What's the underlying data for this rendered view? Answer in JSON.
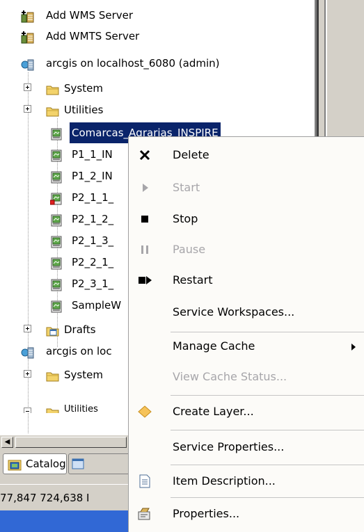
{
  "tree": {
    "nodes": [
      {
        "label": "Add WMS Server",
        "icon": "add-wms-server-icon"
      },
      {
        "label": "Add WMTS Server",
        "icon": "add-wmts-server-icon"
      },
      {
        "label": "arcgis on localhost_6080 (admin)",
        "icon": "arcgis-server-connection-icon"
      },
      {
        "label": "System",
        "icon": "folder-icon"
      },
      {
        "label": "Utilities",
        "icon": "folder-icon"
      },
      {
        "label": "Comarcas_Agrarias_INSPIRE",
        "icon": "map-service-icon"
      },
      {
        "label": "P1_1_IN",
        "icon": "map-service-icon"
      },
      {
        "label": "P1_2_IN",
        "icon": "map-service-icon"
      },
      {
        "label": "P2_1_1_",
        "icon": "map-service-stopped-icon"
      },
      {
        "label": "P2_1_2_",
        "icon": "map-service-icon"
      },
      {
        "label": "P2_1_3_",
        "icon": "map-service-icon"
      },
      {
        "label": "P2_2_1_",
        "icon": "map-service-icon"
      },
      {
        "label": "P2_3_1_",
        "icon": "map-service-icon"
      },
      {
        "label": "SampleW",
        "icon": "map-service-icon"
      },
      {
        "label": "Drafts",
        "icon": "drafts-folder-icon"
      },
      {
        "label": "arcgis on loc",
        "icon": "arcgis-server-connection-icon"
      },
      {
        "label": "System",
        "icon": "folder-icon"
      },
      {
        "label": "Utilities",
        "icon": "folder-icon"
      }
    ]
  },
  "tabs": {
    "catalog_label": "Catalog"
  },
  "status": {
    "coordinates": "77,847  724,638 I"
  },
  "context_menu": {
    "items": [
      {
        "label": "Delete",
        "enabled": true,
        "icon": "delete-x-icon"
      },
      {
        "label": "Start",
        "enabled": false,
        "icon": "start-play-icon"
      },
      {
        "label": "Stop",
        "enabled": true,
        "icon": "stop-square-icon"
      },
      {
        "label": "Pause",
        "enabled": false,
        "icon": "pause-icon"
      },
      {
        "label": "Restart",
        "enabled": true,
        "icon": "restart-icon"
      },
      {
        "label": "Service Workspaces...",
        "enabled": true,
        "icon": ""
      },
      {
        "label": "Manage Cache",
        "enabled": true,
        "icon": "",
        "submenu": true
      },
      {
        "label": "View Cache Status...",
        "enabled": false,
        "icon": ""
      },
      {
        "label": "Create Layer...",
        "enabled": true,
        "icon": "create-layer-diamond-icon"
      },
      {
        "label": "Service Properties...",
        "enabled": true,
        "icon": ""
      },
      {
        "label": "Item Description...",
        "enabled": true,
        "icon": "item-description-icon"
      },
      {
        "label": "Properties...",
        "enabled": true,
        "icon": "properties-icon"
      }
    ]
  },
  "colors": {
    "selection": "#0a246a",
    "taskbar": "#3168d5",
    "chrome": "#d4d0c8",
    "menu_bg": "#fcfbf8",
    "disabled_text": "#a7a6aa"
  }
}
